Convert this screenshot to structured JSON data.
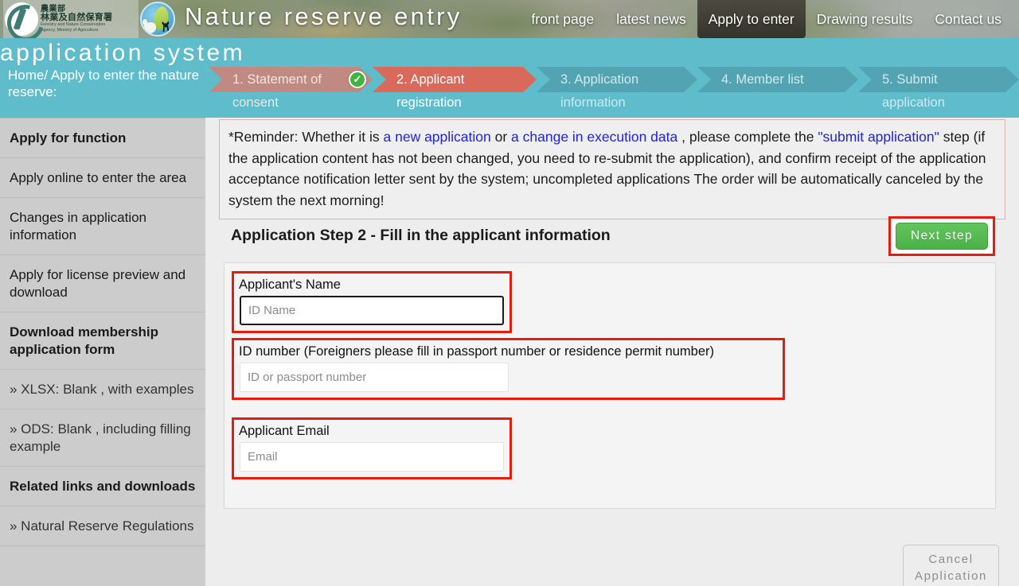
{
  "banner": {
    "logo_cn_line1": "農業部",
    "logo_cn_line2": "林業及自然保育署",
    "logo_en_line1": "Forestry and Nature Conservation",
    "logo_en_line2": "Agency, Ministry of Agriculture",
    "site_title": "Nature reserve entry",
    "site_title_line2": "application system",
    "nav": [
      {
        "label": "front page",
        "active": false
      },
      {
        "label": "latest news",
        "active": false
      },
      {
        "label": "Apply to enter",
        "active": true
      },
      {
        "label": "Drawing results",
        "active": false
      },
      {
        "label": "Contact us",
        "active": false
      }
    ]
  },
  "breadcrumb": "Home/ Apply to enter the nature reserve:",
  "steps": [
    {
      "label": "1. Statement of",
      "sub": "consent",
      "state": "done",
      "check": true
    },
    {
      "label": "2. Applicant",
      "sub": "registration",
      "state": "current",
      "check": false
    },
    {
      "label": "3. Application",
      "sub": "information",
      "state": "todo",
      "check": false
    },
    {
      "label": "4. Member list",
      "sub": "",
      "state": "todo",
      "check": false
    },
    {
      "label": "5. Submit",
      "sub": "application",
      "state": "todo",
      "check": false
    }
  ],
  "sidebar": {
    "items": [
      {
        "label": "Apply for function",
        "bold": true
      },
      {
        "label": "Apply online to enter the area",
        "bold": false
      },
      {
        "label": "Changes in application information",
        "bold": false
      },
      {
        "label": "Apply for license preview and download",
        "bold": false
      },
      {
        "label": "Download membership application form",
        "bold": true
      },
      {
        "label": "» XLSX: Blank , with examples",
        "bold": false
      },
      {
        "label": "» ODS: Blank , including filling example",
        "bold": false
      },
      {
        "label": "Related links and downloads",
        "bold": true
      },
      {
        "label": "» Natural Reserve Regulations",
        "bold": false
      }
    ]
  },
  "reminder": {
    "p1": "*Reminder: Whether it is ",
    "link1": "a new application",
    "p2": " or ",
    "link2": "a change in execution data",
    "p3": " , please complete the ",
    "link3": "\"submit application\"",
    "p4": " step (if the application content has not been changed, you need to re-submit the application), and confirm receipt of the application acceptance notification letter sent by the system; uncompleted applications The order will be automatically canceled by the system the next morning!"
  },
  "content": {
    "page_title": "Application Step 2 - Fill in the applicant information",
    "next_label": "Next step",
    "cancel_line1": "Cancel",
    "cancel_line2": "Application"
  },
  "fields": [
    {
      "label": "Applicant's Name",
      "placeholder": "ID Name",
      "value": "",
      "focused": true
    },
    {
      "label": "ID number (Foreigners please fill in passport number or residence permit number)",
      "placeholder": "ID or passport number",
      "value": "",
      "focused": false
    },
    {
      "label": "Applicant Email",
      "placeholder": "Email",
      "value": "",
      "focused": false
    }
  ],
  "colors": {
    "teal": "#5fbccb",
    "step_done": "#c08a82",
    "step_current": "#d9695a",
    "step_todo": "#52a4b2",
    "highlight_red": "#e81c0c",
    "next_green": "#4bb247",
    "link_blue": "#1f22e0"
  }
}
